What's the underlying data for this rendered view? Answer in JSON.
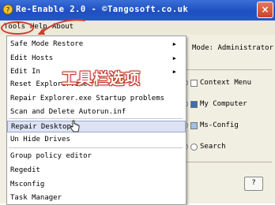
{
  "window": {
    "title": "Re-Enable 2.0  - ©Tangosoft.co.uk",
    "close_label": "×"
  },
  "menubar": {
    "tools": "Tools",
    "help": "Help",
    "about": "About"
  },
  "tools_menu": {
    "items": [
      {
        "label": "Safe Mode Restore",
        "submenu": true
      },
      {
        "label": "Edit Hosts",
        "submenu": true
      },
      {
        "label": "Edit In",
        "submenu": true
      },
      {
        "label": "Reset Explorer.exe",
        "submenu": false
      },
      {
        "label": "Repair Explorer.exe Startup problems",
        "submenu": false
      },
      {
        "label": "Scan and Delete Autorun.inf",
        "submenu": false
      },
      {
        "label": "Repair Desktop",
        "submenu": false,
        "highlighted": true
      },
      {
        "label": "Un Hide Drives",
        "submenu": false
      },
      {
        "label": "Group policy editor",
        "submenu": false
      },
      {
        "label": "Regedit",
        "submenu": false
      },
      {
        "label": "Msconfig",
        "submenu": false
      },
      {
        "label": "Task Manager",
        "submenu": false
      }
    ],
    "submenu_arrow": "▶"
  },
  "main": {
    "mode_text": "Mode: Administrator",
    "options": [
      {
        "label": "Context Menu"
      },
      {
        "label": "My Computer"
      },
      {
        "label": "Ms-Config"
      },
      {
        "label": "Search"
      }
    ],
    "help_button": "?"
  },
  "annotation": {
    "overlay_text": "工具栏选项"
  },
  "colors": {
    "titlebar": "#2457c8",
    "annotation_red": "#d23a2e",
    "highlight": "#dde3f5"
  }
}
